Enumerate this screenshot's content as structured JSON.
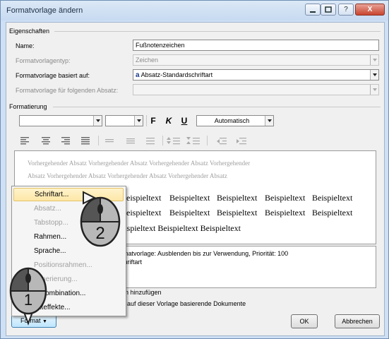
{
  "window": {
    "title": "Formatvorlage ändern",
    "buttons": {
      "help": "?",
      "close": "X",
      "minimize": "_",
      "maximize": "□"
    }
  },
  "properties": {
    "section_label": "Eigenschaften",
    "name_label": "Name:",
    "name_value": "Fußnotenzeichen",
    "type_label": "Formatvorlagentyp:",
    "type_value": "Zeichen",
    "based_on_label": "Formatvorlage basiert auf:",
    "based_on_value": "Absatz-Standardschriftart",
    "based_on_icon": "a",
    "following_label": "Formatvorlage für folgenden Absatz:",
    "following_value": ""
  },
  "formatting": {
    "section_label": "Formatierung",
    "font_name": "",
    "font_size": "",
    "bold": "F",
    "italic": "K",
    "underline": "U",
    "color_value": "Automatisch"
  },
  "preview": {
    "previous_paragraph": [
      "Vorhergehender Absatz Vorhergehender Absatz Vorhergehender Absatz Vorhergehender",
      "Absatz Vorhergehender Absatz Vorhergehender Absatz Vorhergehender Absatz"
    ],
    "sample_line1": [
      "Beispieltext",
      "Beispieltext",
      "Beispieltext",
      "Beispieltext",
      "Beispieltext"
    ],
    "sample_line2": [
      "Beispieltext",
      "Beispieltext",
      "Beispieltext",
      "Beispieltext",
      "Beispieltext"
    ],
    "sample_line3": "eispieltext Beispieltext Beispieltext"
  },
  "description": {
    "line1": "rmatvorlage: Ausblenden bis zur Verwendung, Priorität: 100",
    "line2": "chriftart"
  },
  "options": {
    "add_label": "n hinzufügen",
    "update_label": "auf dieser Vorlage basierende Dokumente"
  },
  "buttons": {
    "format": "Format",
    "ok": "OK",
    "cancel": "Abbrechen"
  },
  "menu": {
    "items": [
      {
        "label": "Schriftart...",
        "state": "highlighted"
      },
      {
        "label": "Absatz...",
        "state": "disabled"
      },
      {
        "label": "Tabstopp...",
        "state": "disabled"
      },
      {
        "label": "Rahmen...",
        "state": "enabled"
      },
      {
        "label": "Sprache...",
        "state": "enabled"
      },
      {
        "label": "Positionsrahmen...",
        "state": "disabled"
      },
      {
        "label": "mmerierung...",
        "state": "disabled"
      },
      {
        "label": "enkombination...",
        "state": "enabled"
      },
      {
        "label": "exteffekte...",
        "state": "enabled"
      }
    ]
  },
  "annotations": {
    "step1": "1",
    "step2": "2"
  },
  "colors": {
    "title_bar": "#c7daf1",
    "menu_highlight": "#fde7a6",
    "preview_gray": "#a0a0a0"
  }
}
